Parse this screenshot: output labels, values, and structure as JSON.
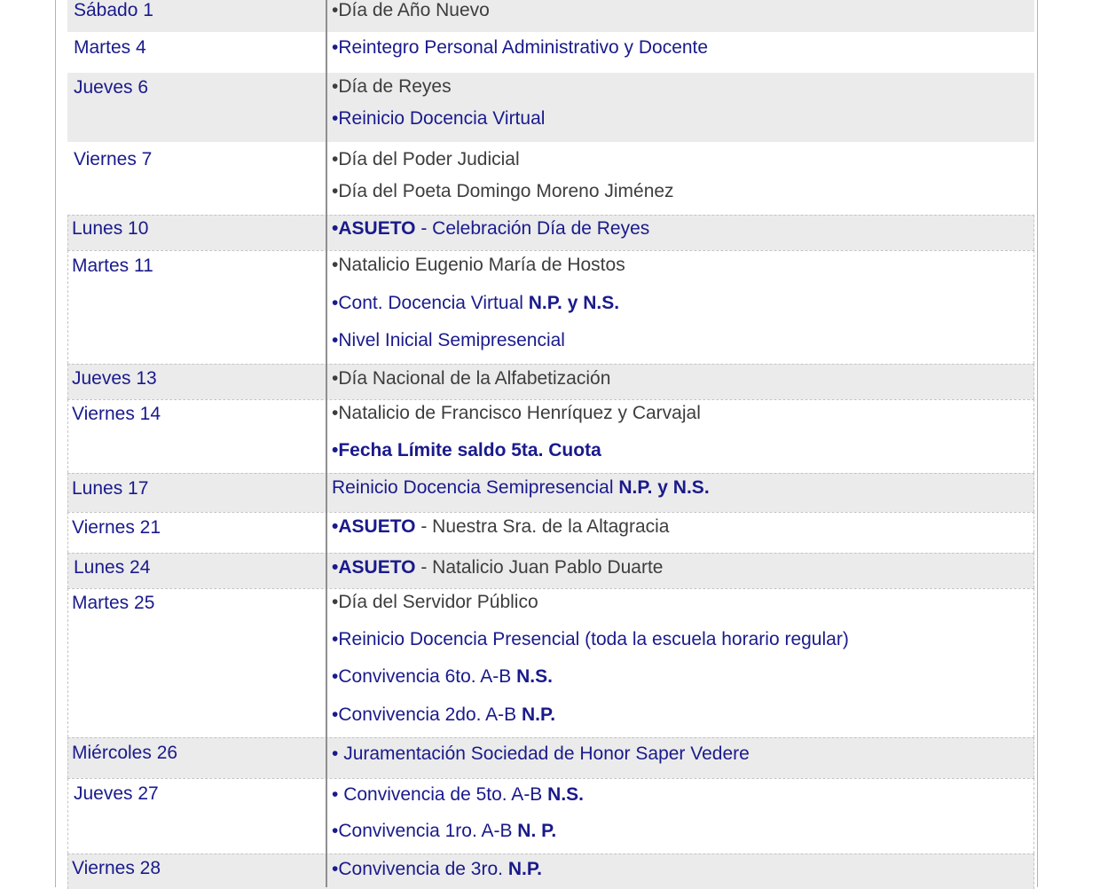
{
  "calendar": {
    "rows": [
      {
        "date": "Sábado 1",
        "events": [
          {
            "bullet": "•",
            "text": "Día de Año Nuevo",
            "color": "dark"
          }
        ]
      },
      {
        "date": "Martes 4",
        "events": [
          {
            "bullet": "•",
            "text": "Reintegro Personal Administrativo y Docente",
            "color": "blue"
          }
        ]
      },
      {
        "date": "Jueves 6",
        "events": [
          {
            "bullet": "•",
            "text": "Día de Reyes",
            "color": "dark"
          },
          {
            "bullet": "•",
            "text": "Reinicio Docencia Virtual",
            "color": "blue"
          }
        ]
      },
      {
        "date": "Viernes 7",
        "events": [
          {
            "bullet": "•",
            "text": "Día del Poder Judicial",
            "color": "dark"
          },
          {
            "bullet": "•",
            "text": "Día del Poeta Domingo Moreno Jiménez",
            "color": "dark"
          }
        ]
      },
      {
        "date": "Lunes 10",
        "events": [
          {
            "bullet": "•",
            "bold": "ASUETO",
            "text": " - Celebración Día de Reyes",
            "color": "blue"
          }
        ]
      },
      {
        "date": "Martes 11",
        "events": [
          {
            "bullet": "•",
            "text": "Natalicio Eugenio María de Hostos",
            "color": "dark"
          },
          {
            "bullet": "•",
            "text": "Cont. Docencia Virtual ",
            "tail": "N.P. y N.S.",
            "color": "blue"
          },
          {
            "bullet": "•",
            "text": "Nivel Inicial Semipresencial",
            "color": "blue"
          }
        ]
      },
      {
        "date": "Jueves 13",
        "events": [
          {
            "bullet": "•",
            "text": "Día Nacional de la Alfabetización",
            "color": "dark"
          }
        ]
      },
      {
        "date": "Viernes 14",
        "events": [
          {
            "bullet": "•",
            "text": "Natalicio de Francisco Henríquez y Carvajal",
            "color": "dark"
          },
          {
            "bullet": "•",
            "bold": "Fecha Límite saldo 5ta. Cuota",
            "color": "blue"
          }
        ]
      },
      {
        "date": "Lunes 17",
        "events": [
          {
            "bullet": "",
            "text": "Reinicio Docencia Semipresencial ",
            "tail": "N.P. y N.S.",
            "color": "blue"
          }
        ]
      },
      {
        "date": "Viernes 21",
        "events": [
          {
            "bullet": "•",
            "bold": "ASUETO",
            "text": " - Nuestra Sra. de la Altagracia",
            "color": "dark"
          }
        ]
      },
      {
        "date": "Lunes 24",
        "events": [
          {
            "bullet": "•",
            "bold": "ASUETO",
            "text": " - Natalicio Juan Pablo Duarte",
            "color": "dark"
          }
        ]
      },
      {
        "date": "Martes 25",
        "events": [
          {
            "bullet": "•",
            "text": "Día del Servidor Público",
            "color": "dark"
          },
          {
            "bullet": "•",
            "text": "Reinicio Docencia Presencial (toda la escuela horario regular)",
            "color": "blue"
          },
          {
            "bullet": "•",
            "text": "Convivencia 6to. A-B ",
            "tail": "N.S.",
            "color": "blue"
          },
          {
            "bullet": "•",
            "text": "Convivencia 2do. A-B ",
            "tail": "N.P.",
            "color": "blue"
          }
        ]
      },
      {
        "date": "Miércoles 26",
        "events": [
          {
            "bullet": "• ",
            "text": "Juramentación Sociedad de Honor Saper Vedere",
            "color": "blue"
          }
        ]
      },
      {
        "date": "Jueves 27",
        "events": [
          {
            "bullet": "• ",
            "text": "Convivencia de 5to. A-B ",
            "tail": "N.S.",
            "color": "blue"
          },
          {
            "bullet": "•",
            "text": "Convivencia 1ro. A-B ",
            "tail": "N. P.",
            "color": "blue"
          }
        ]
      },
      {
        "date": "Viernes 28",
        "events": [
          {
            "bullet": "•",
            "text": "Convivencia de 3ro. ",
            "tail": "N.P.",
            "color": "blue"
          }
        ]
      }
    ]
  }
}
